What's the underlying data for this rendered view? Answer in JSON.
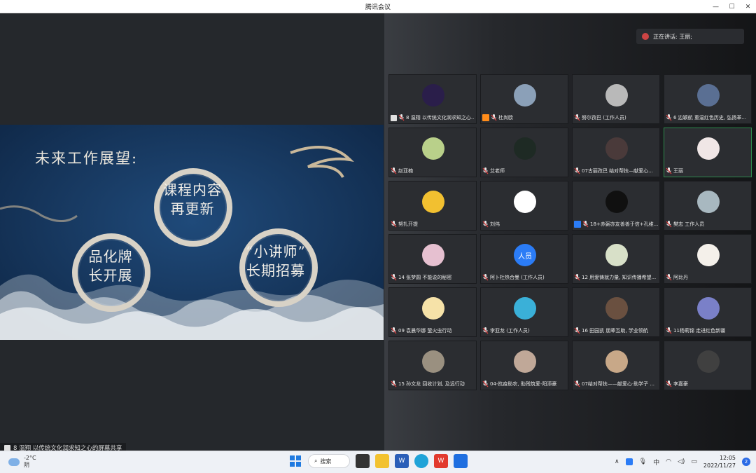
{
  "window": {
    "title": "腾讯会议"
  },
  "slide": {
    "heading": "未来工作展望:",
    "bubble1": [
      "课程内容",
      "再更新"
    ],
    "bubble2": [
      "品化牌",
      "长开展"
    ],
    "bubble3": [
      "“小讲师”",
      "长期招募"
    ]
  },
  "share_bar": {
    "text": "8 温翔 以传统文化润求知之心的屏幕共享"
  },
  "speaking": {
    "text": "正在讲话: 王丽;"
  },
  "participants": [
    {
      "label": "8 温翔 以传统文化润求知之心...",
      "badge": "share",
      "bg": "#2a1e4a"
    },
    {
      "label": "杜尚欧",
      "badge": "host",
      "bg": "#8ba0b8"
    },
    {
      "label": "努尔孜巴 (工作人员)",
      "badge": "",
      "bg": "#b9b9b9"
    },
    {
      "label": "6 边颖航 重温红色历史, 弘扬革...",
      "badge": "",
      "bg": "#5a6f93"
    },
    {
      "label": "赵亚楠",
      "badge": "",
      "bg": "#b9d08a"
    },
    {
      "label": "艾老师",
      "badge": "",
      "bg": "#1e2a24"
    },
    {
      "label": "07古丽孜巴 结对帮扶—献爱心...",
      "badge": "",
      "bg": "#4a3a3a"
    },
    {
      "label": "王丽",
      "badge": "",
      "bg": "#f0e6e6",
      "active": true
    },
    {
      "label": "努扎开提",
      "badge": "",
      "bg": "#f2c030"
    },
    {
      "label": "刘伟",
      "badge": "",
      "bg": "#ffffff"
    },
    {
      "label": "18+赤弼亦友善善于信+孔维...",
      "badge": "user",
      "bg": "#101010"
    },
    {
      "label": "樊志 工作人员",
      "badge": "",
      "bg": "#a8b8c0"
    },
    {
      "label": "14 张梦圆 不能说的秘密",
      "badge": "",
      "bg": "#e6c0d0"
    },
    {
      "label": "阿卜杜热合曼 (工作人员)",
      "badge": "",
      "bg": "#2b7cf6",
      "text": "人员"
    },
    {
      "label": "12 用爱铸就力量, 知识传播希望...",
      "badge": "",
      "bg": "#d8e0c8"
    },
    {
      "label": "阿比丹",
      "badge": "",
      "bg": "#f4f0ea"
    },
    {
      "label": "09 袁晨华娜 萤火虫行动",
      "badge": "",
      "bg": "#f6e2a8"
    },
    {
      "label": "李亚龙 (工作人员)",
      "badge": "",
      "bg": "#3ab0d8"
    },
    {
      "label": "16 田园凯 朋辈互助, 学业领航",
      "badge": "",
      "bg": "#6a5040"
    },
    {
      "label": "11杨莉锦 走进红色新疆",
      "badge": "",
      "bg": "#7a80c8"
    },
    {
      "label": "15 孙文龙 回收计划, 及远行动",
      "badge": "",
      "bg": "#9a9080"
    },
    {
      "label": "04-抗疫助农, 助残筑爱-阳添豪",
      "badge": "",
      "bg": "#c0a898"
    },
    {
      "label": "07结对帮扶——献爱心·助学子 ...",
      "badge": "",
      "bg": "#c8a888"
    },
    {
      "label": "李嘉豪",
      "badge": "",
      "bg": "#404040"
    }
  ],
  "taskbar": {
    "weather_temp": "-2°C",
    "weather_desc": "阴",
    "search": "搜索",
    "ime": "中",
    "time": "12:05",
    "date": "2022/11/27",
    "notifications": "2"
  }
}
